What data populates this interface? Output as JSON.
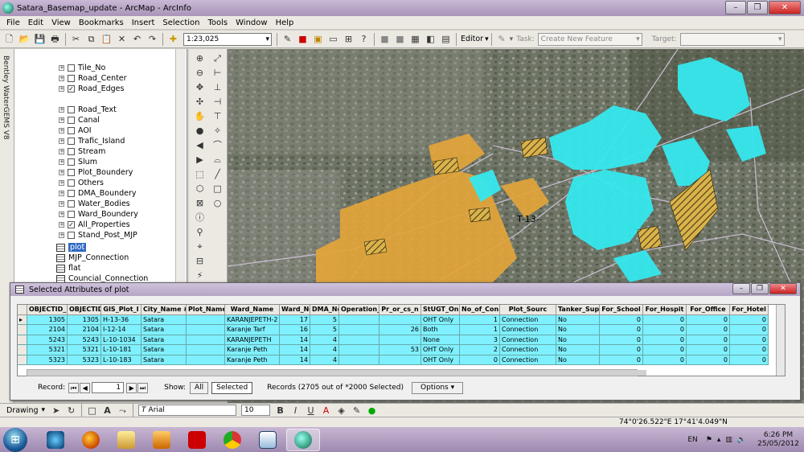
{
  "window": {
    "title": "Satara_Basemap_update - ArcMap - ArcInfo"
  },
  "menu": [
    "File",
    "Edit",
    "View",
    "Bookmarks",
    "Insert",
    "Selection",
    "Tools",
    "Window",
    "Help"
  ],
  "toolbar": {
    "scale": "1:23,025",
    "editor_label": "Editor",
    "task_label": "Task:",
    "task_value": "Create New Feature",
    "target_label": "Target:"
  },
  "side_panel": {
    "vertical_label": "Bentley WaterGEMS V8"
  },
  "toc": {
    "layers": [
      {
        "name": "Tile_No",
        "checked": false
      },
      {
        "name": "Road_Center",
        "checked": false
      },
      {
        "name": "Road_Edges",
        "checked": true
      },
      {
        "name": "Road_Text",
        "checked": false
      },
      {
        "name": "Canal",
        "checked": false
      },
      {
        "name": "AOI",
        "checked": false
      },
      {
        "name": "Trafic_Island",
        "checked": false
      },
      {
        "name": "Stream",
        "checked": false
      },
      {
        "name": "Slum",
        "checked": false
      },
      {
        "name": "Plot_Boundery",
        "checked": false
      },
      {
        "name": "Others",
        "checked": false
      },
      {
        "name": "DMA_Boundery",
        "checked": false
      },
      {
        "name": "Water_Bodies",
        "checked": false
      },
      {
        "name": "Ward_Boundery",
        "checked": false
      },
      {
        "name": "All_Properties",
        "checked": true
      },
      {
        "name": "Stand_Post_MJP",
        "checked": false
      }
    ],
    "tables": [
      "plot",
      "MJP_Connection",
      "flat",
      "Councial_Connection"
    ]
  },
  "map": {
    "label": "T-13-"
  },
  "attributes": {
    "title": "Selected Attributes of plot",
    "columns": [
      "OBJECTID_1",
      "OBJECTID",
      "GIS_Plot_I",
      "City_Name #",
      "Plot_Name",
      "Ward_Name",
      "Ward_No",
      "DMA_No",
      "Operation_",
      "Pr_or_cs_n",
      "StUGT_Only",
      "No_of_Conn",
      "Plot_Sourc",
      "Tanker_Sup",
      "For_School",
      "For_Hospit",
      "For_Office",
      "For_Hotel"
    ],
    "rows": [
      [
        "1305",
        "1305",
        "H-13-36",
        "Satara",
        "",
        "KARANJEPETH-2",
        "17",
        "5",
        "",
        "",
        "OHT Only",
        "1",
        "Connection",
        "No",
        "0",
        "0",
        "0",
        "0"
      ],
      [
        "2104",
        "2104",
        "I-12-14",
        "Satara",
        "",
        "Karanje Tarf",
        "16",
        "5",
        "",
        "26",
        "Both",
        "1",
        "Connection",
        "No",
        "0",
        "0",
        "0",
        "0"
      ],
      [
        "5243",
        "5243",
        "L-10-1034",
        "Satara",
        "",
        "KARANJEPETH",
        "14",
        "4",
        "",
        "",
        "None",
        "3",
        "Connection",
        "No",
        "0",
        "0",
        "0",
        "0"
      ],
      [
        "5321",
        "5321",
        "L-10-181",
        "Satara",
        "",
        "Karanje Peth",
        "14",
        "4",
        "",
        "53",
        "OHT Only",
        "2",
        "Connection",
        "No",
        "0",
        "0",
        "0",
        "0"
      ],
      [
        "5323",
        "5323",
        "L-10-183",
        "Satara",
        "",
        "Karanje Peth",
        "14",
        "4",
        "",
        "",
        "OHT Only",
        "0",
        "Connection",
        "No",
        "0",
        "0",
        "0",
        "0"
      ]
    ],
    "record_label": "Record:",
    "record_value": "1",
    "show_label": "Show:",
    "show_all": "All",
    "show_selected": "Selected",
    "records_text": "Records (2705 out of *2000 Selected)",
    "options_label": "Options"
  },
  "drawing": {
    "label": "Drawing",
    "font": "Arial",
    "size": "10",
    "bold": "B",
    "italic": "I",
    "underline": "U"
  },
  "status": {
    "coordinates": "74°0'26.522\"E  17°41'4.049\"N"
  },
  "taskbar": {
    "lang": "EN",
    "time": "6:26 PM",
    "date": "25/05/2012"
  },
  "colors": {
    "parcels_orange": "#e3a53a",
    "parcels_cyan": "#35e8ee",
    "selected_row": "#7ff0ff",
    "title_bar": "#b9a8c9"
  }
}
